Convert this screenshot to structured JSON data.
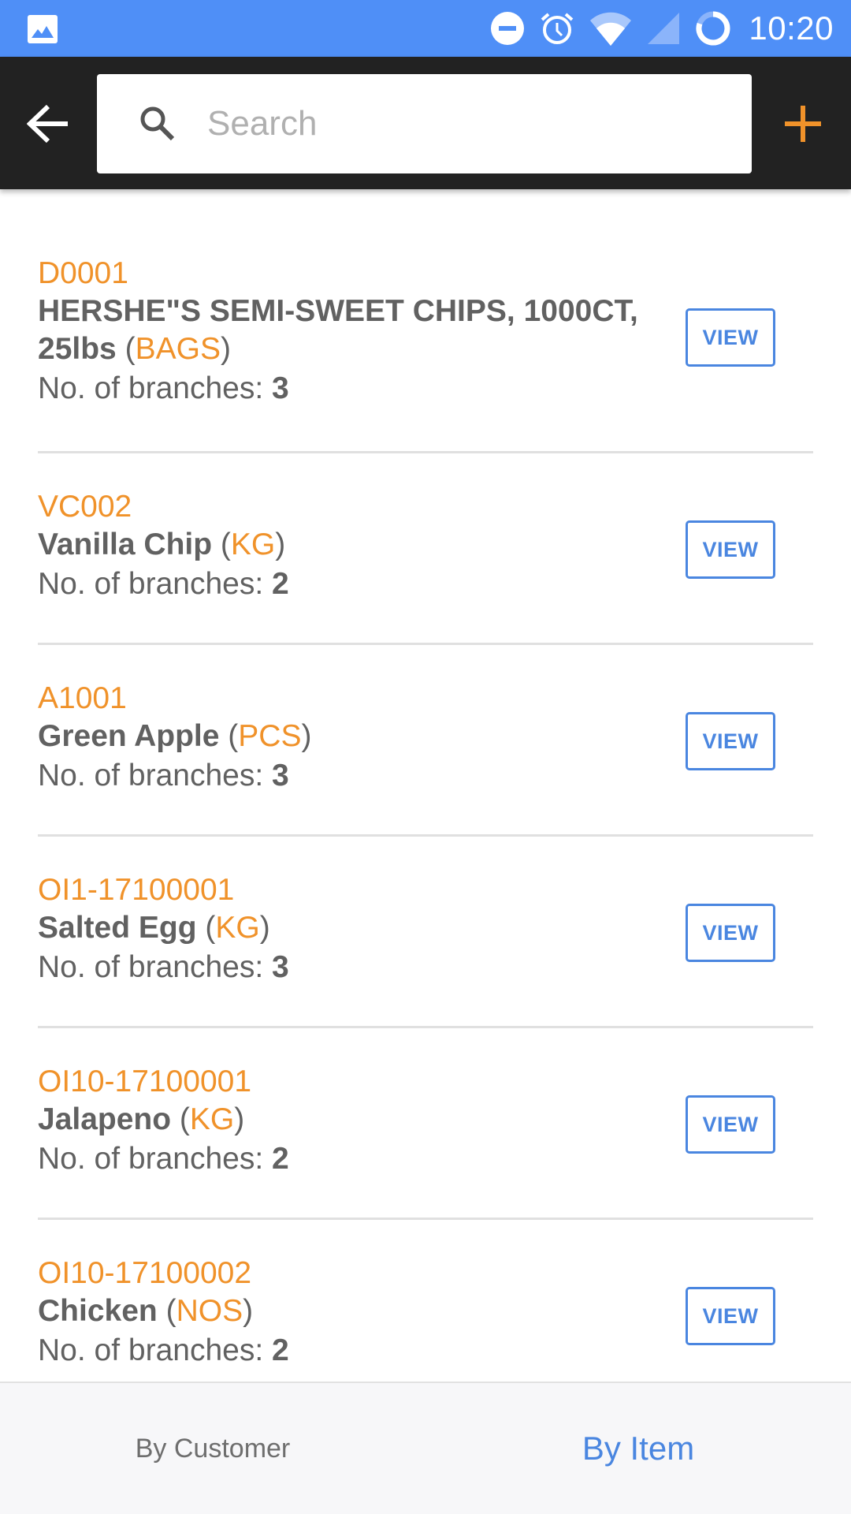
{
  "status_bar": {
    "left_icon": "image-notification-icon",
    "icons": [
      "do-not-disturb-icon",
      "alarm-icon",
      "wifi-icon",
      "cell-signal-icon",
      "sync-loading-icon"
    ],
    "time": "10:20",
    "bg_color": "#4f8ff7"
  },
  "toolbar": {
    "back_icon": "arrow-back-icon",
    "search": {
      "placeholder": "Search",
      "value": "",
      "icon": "search-icon"
    },
    "add_icon": "plus-icon",
    "accent_color": "#f0922a"
  },
  "items": [
    {
      "code": "D0001",
      "name": "HERSHE\"S SEMI-SWEET CHIPS, 1000CT, 25lbs",
      "unit": "BAGS",
      "branches_label": "No. of branches: ",
      "branches": "3",
      "button": "VIEW"
    },
    {
      "code": "VC002",
      "name": "Vanilla Chip",
      "unit": "KG",
      "branches_label": "No. of branches: ",
      "branches": "2",
      "button": "VIEW"
    },
    {
      "code": "A1001",
      "name": "Green Apple",
      "unit": "PCS",
      "branches_label": "No. of branches: ",
      "branches": "3",
      "button": "VIEW"
    },
    {
      "code": "OI1-17100001",
      "name": "Salted Egg",
      "unit": "KG",
      "branches_label": "No. of branches: ",
      "branches": "3",
      "button": "VIEW"
    },
    {
      "code": "OI10-17100001",
      "name": "Jalapeno",
      "unit": "KG",
      "branches_label": "No. of branches: ",
      "branches": "2",
      "button": "VIEW"
    },
    {
      "code": "OI10-17100002",
      "name": "Chicken",
      "unit": "NOS",
      "branches_label": "No. of branches: ",
      "branches": "2",
      "button": "VIEW"
    }
  ],
  "bottom_tabs": [
    {
      "label": "By Customer",
      "active": false
    },
    {
      "label": "By Item",
      "active": true
    }
  ],
  "colors": {
    "code": "#f0922a",
    "text": "#616161",
    "link": "#4a86e0"
  }
}
